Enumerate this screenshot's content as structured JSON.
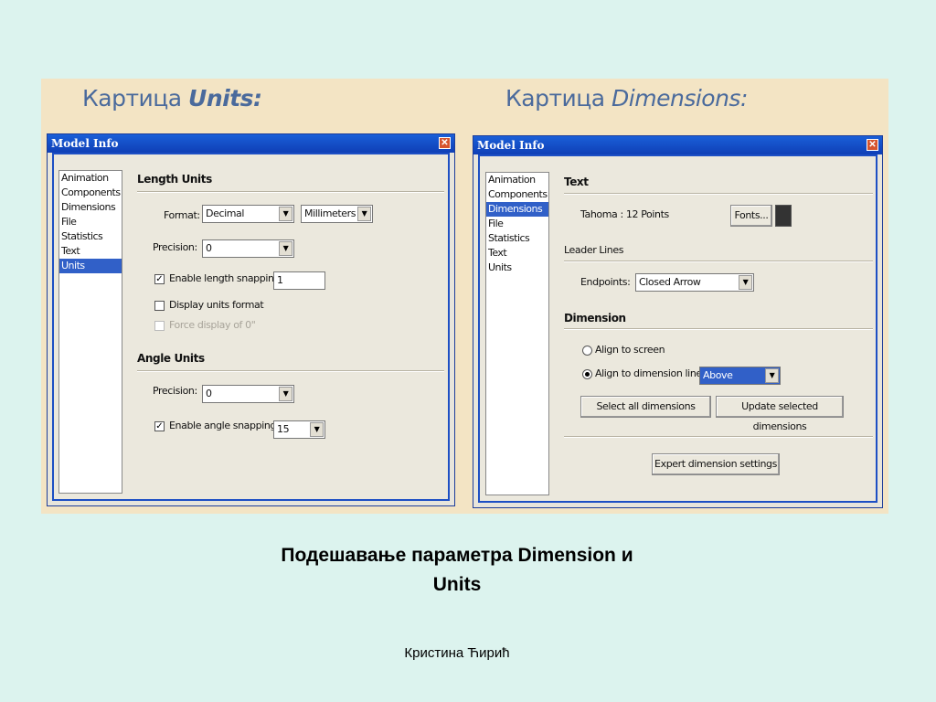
{
  "captions": {
    "units": {
      "prefix": "Картица",
      "name": "Units:"
    },
    "dimensions": {
      "prefix": "Картица",
      "name": "Dimensions:"
    }
  },
  "dialog_title": "Model Info",
  "nav_items": [
    "Animation",
    "Components",
    "Dimensions",
    "File",
    "Statistics",
    "Text",
    "Units"
  ],
  "units_dialog": {
    "selected_nav": "Units",
    "length_units_header": "Length Units",
    "format_label": "Format:",
    "format_value": "Decimal",
    "unit_value": "Millimeters",
    "precision_label": "Precision:",
    "precision_value": "0",
    "enable_length_snapping_label": "Enable length snapping",
    "length_snapping_value": "1",
    "display_units_format_label": "Display units format",
    "force_display_label": "Force display of 0\"",
    "angle_units_header": "Angle Units",
    "angle_precision_label": "Precision:",
    "angle_precision_value": "0",
    "enable_angle_snapping_label": "Enable angle snapping",
    "angle_snapping_value": "15"
  },
  "dimensions_dialog": {
    "selected_nav": "Dimensions",
    "text_header": "Text",
    "font_info": "Tahoma : 12 Points",
    "fonts_button": "Fonts...",
    "leader_lines_header": "Leader Lines",
    "endpoints_label": "Endpoints:",
    "endpoints_value": "Closed Arrow",
    "dimension_header": "Dimension",
    "align_screen_label": "Align to screen",
    "align_dimension_label": "Align to dimension line",
    "align_value": "Above",
    "select_all_button": "Select all dimensions",
    "update_selected_button": "Update selected dimensions",
    "expert_button": "Expert dimension settings"
  },
  "main_title_line1": "Подешавање параметра Dimension и",
  "main_title_line2": "Units",
  "author": "Кристина Ћирић"
}
